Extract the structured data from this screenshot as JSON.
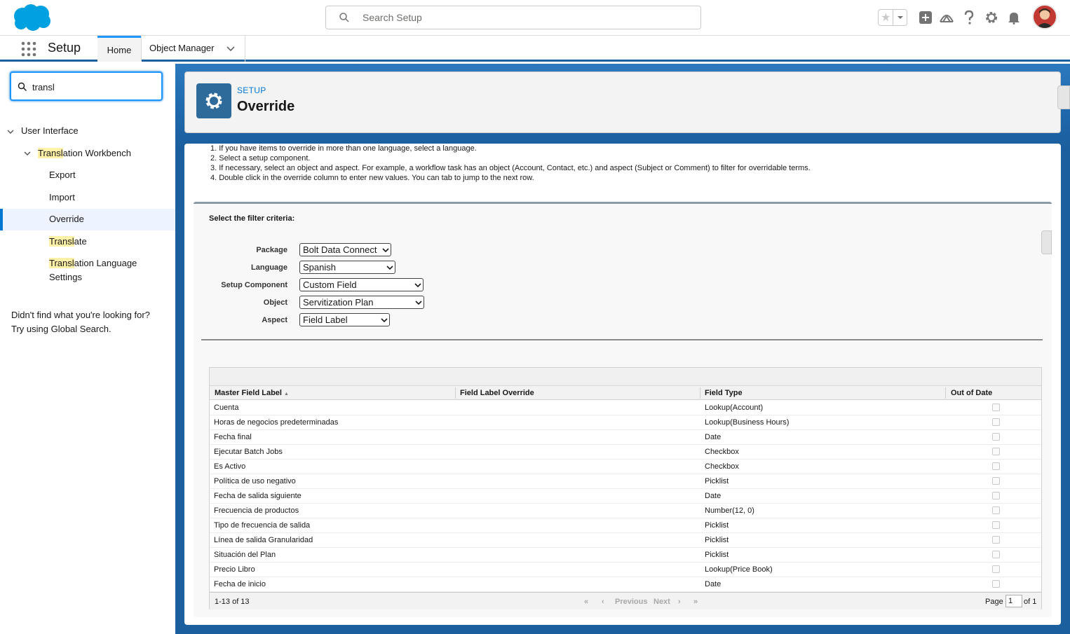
{
  "header": {
    "search_placeholder": "Search Setup",
    "icons": [
      "salesforce-cloud-logo",
      "search-icon",
      "star-icon",
      "chevron-down-icon",
      "add-icon",
      "trailhead-icon",
      "help-icon",
      "gear-icon",
      "bell-icon",
      "avatar"
    ]
  },
  "nav": {
    "app_name": "Setup",
    "tabs": [
      {
        "label": "Home",
        "active": true
      },
      {
        "label": "Object Manager",
        "active": false
      }
    ]
  },
  "sidebar": {
    "quickfind_value": "transl",
    "tree": {
      "user_interface": "User Interface",
      "workbench_hl": "Transl",
      "workbench_rest": "ation Workbench",
      "export": "Export",
      "import": "Import",
      "override": "Override",
      "translate_hl": "Transl",
      "translate_rest": "ate",
      "tls_hl": "Transl",
      "tls_rest1": "ation Language",
      "tls_rest2": "Settings"
    },
    "not_found_line1": "Didn't find what you're looking for?",
    "not_found_line2": "Try using Global Search."
  },
  "page": {
    "eyebrow": "SETUP",
    "title": "Override"
  },
  "instructions": [
    "1. If you have items to override in more than one language, select a language.",
    "2. Select a setup component.",
    "3. If necessary, select an object and aspect. For example, a workflow task has an object (Account, Contact, etc.) and aspect (Subject or Comment) to filter for overridable terms.",
    "4. Double click in the override column to enter new values. You can tab to jump to the next row."
  ],
  "filter": {
    "title": "Select the filter criteria:",
    "package_label": "Package",
    "package_value": "Bolt Data Connect",
    "language_label": "Language",
    "language_value": "Spanish",
    "component_label": "Setup Component",
    "component_value": "Custom Field",
    "object_label": "Object",
    "object_value": "Servitization Plan",
    "aspect_label": "Aspect",
    "aspect_value": "Field Label"
  },
  "grid": {
    "columns": {
      "master": "Master Field Label",
      "override": "Field Label Override",
      "type": "Field Type",
      "ood": "Out of Date"
    },
    "rows": [
      {
        "label": "Cuenta",
        "override": "",
        "type": "Lookup(Account)",
        "out_of_date": false
      },
      {
        "label": "Horas de negocios predeterminadas",
        "override": "",
        "type": "Lookup(Business Hours)",
        "out_of_date": false
      },
      {
        "label": "Fecha final",
        "override": "",
        "type": "Date",
        "out_of_date": false
      },
      {
        "label": "Ejecutar Batch Jobs",
        "override": "",
        "type": "Checkbox",
        "out_of_date": false
      },
      {
        "label": "Es Activo",
        "override": "",
        "type": "Checkbox",
        "out_of_date": false
      },
      {
        "label": "Política de uso negativo",
        "override": "",
        "type": "Picklist",
        "out_of_date": false
      },
      {
        "label": "Fecha de salida siguiente",
        "override": "",
        "type": "Date",
        "out_of_date": false
      },
      {
        "label": "Frecuencia de productos",
        "override": "",
        "type": "Number(12, 0)",
        "out_of_date": false
      },
      {
        "label": "Tipo de frecuencia de salida",
        "override": "",
        "type": "Picklist",
        "out_of_date": false
      },
      {
        "label": "Línea de salida Granularidad",
        "override": "",
        "type": "Picklist",
        "out_of_date": false
      },
      {
        "label": "Situación del Plan",
        "override": "",
        "type": "Picklist",
        "out_of_date": false
      },
      {
        "label": "Precio Libro",
        "override": "",
        "type": "Lookup(Price Book)",
        "out_of_date": false
      },
      {
        "label": "Fecha de inicio",
        "override": "",
        "type": "Date",
        "out_of_date": false
      }
    ],
    "footer": {
      "count": "1-13 of 13",
      "previous": "Previous",
      "next": "Next",
      "page_label": "Page",
      "page_value": "1",
      "of_label": "of 1"
    }
  },
  "colors": {
    "brand_blue": "#0176d3",
    "nav_blue": "#1b5f9e",
    "highlight": "#fff2a8"
  }
}
